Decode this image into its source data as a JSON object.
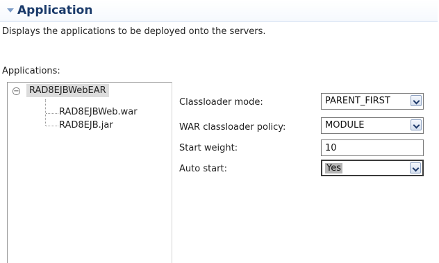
{
  "section": {
    "title": "Application",
    "description": "Displays the applications to be deployed onto the servers."
  },
  "applications": {
    "label": "Applications:",
    "root": "RAD8EJBWebEAR",
    "children": [
      "RAD8EJBWeb.war",
      "RAD8EJB.jar"
    ]
  },
  "settings": {
    "classloader_mode": {
      "label": "Classloader mode:",
      "value": "PARENT_FIRST"
    },
    "war_classloader_policy": {
      "label": "WAR classloader policy:",
      "value": "MODULE"
    },
    "start_weight": {
      "label": "Start weight:",
      "value": "10"
    },
    "auto_start": {
      "label": "Auto start:",
      "value": "Yes"
    }
  }
}
